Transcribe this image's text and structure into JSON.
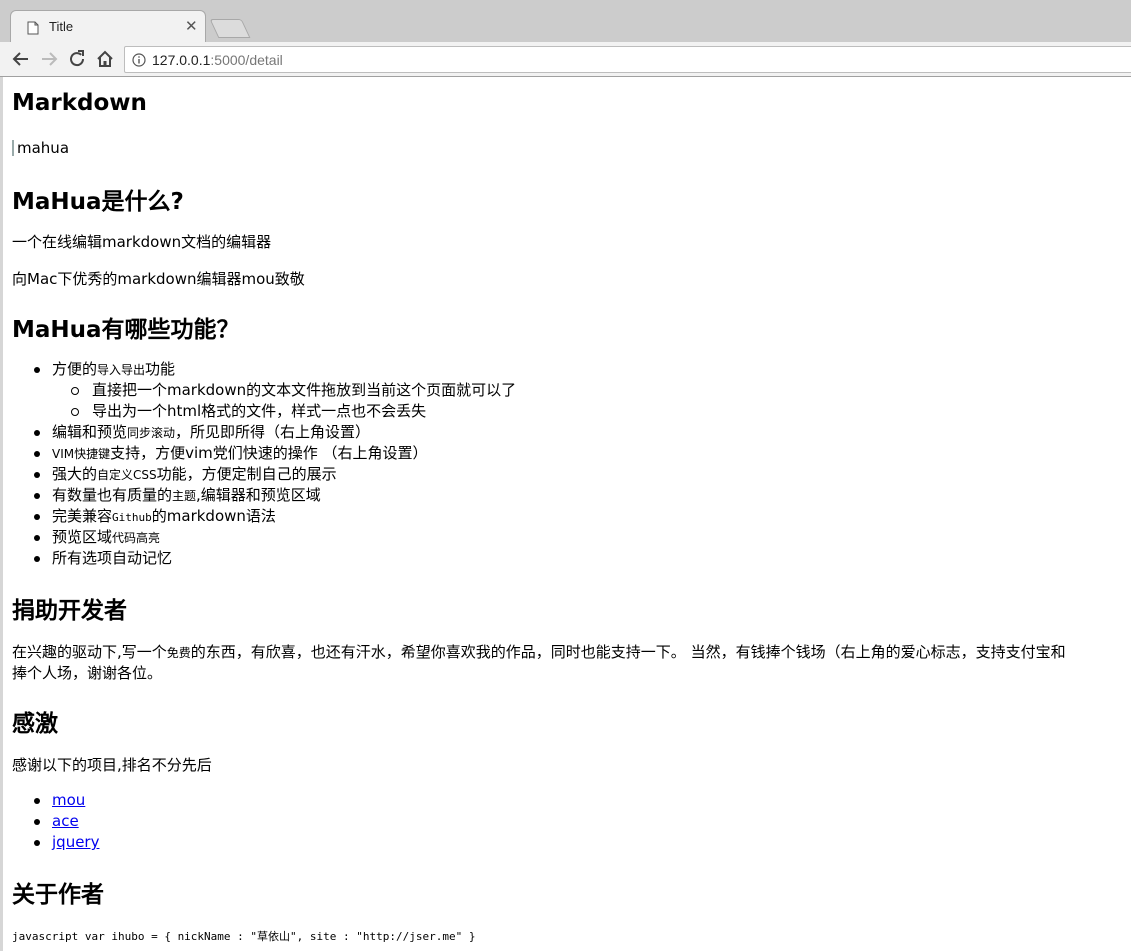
{
  "browser": {
    "tab_title": "Title",
    "url_host": "127.0.0.1",
    "url_rest": ":5000/detail"
  },
  "content": {
    "h_markdown": "Markdown",
    "img_alt": "mahua",
    "h_what": "MaHua是什么?",
    "p_what_1": "一个在线编辑markdown文档的编辑器",
    "p_what_2": "向Mac下优秀的markdown编辑器mou致敬",
    "h_features": "MaHua有哪些功能？",
    "features": {
      "f1_a": "方便的",
      "f1_b": "导入导出",
      "f1_c": "功能",
      "f1_sub1": "直接把一个markdown的文本文件拖放到当前这个页面就可以了",
      "f1_sub2": "导出为一个html格式的文件，样式一点也不会丢失",
      "f2_a": "编辑和预览",
      "f2_b": "同步滚动",
      "f2_c": "，所见即所得（右上角设置）",
      "f3_a": "VIM快捷键",
      "f3_b": "支持，方便vim党们快速的操作 （右上角设置）",
      "f4_a": "强大的",
      "f4_b": "自定义CSS",
      "f4_c": "功能，方便定制自己的展示",
      "f5_a": "有数量也有质量的",
      "f5_b": "主题",
      "f5_c": ",编辑器和预览区域",
      "f6_a": "完美兼容",
      "f6_b": "Github",
      "f6_c": "的markdown语法",
      "f7_a": "预览区域",
      "f7_b": "代码高亮",
      "f8": "所有选项自动记忆"
    },
    "h_donate": "捐助开发者",
    "donate_1": "在兴趣的驱动下,写一个",
    "donate_free": "免费",
    "donate_2": "的东西，有欣喜，也还有汗水，希望你喜欢我的作品，同时也能支持一下。 当然，有钱捧个钱场（右上角的爱心标志，支持支付宝和",
    "donate_line2": "捧个人场，谢谢各位。",
    "h_thanks": "感激",
    "thanks_text": "感谢以下的项目,排名不分先后",
    "links": [
      "mou",
      "ace",
      "jquery"
    ],
    "h_author": "关于作者",
    "code_line": "javascript var ihubo = { nickName : \"草依山\", site : \"http://jser.me\" }"
  }
}
